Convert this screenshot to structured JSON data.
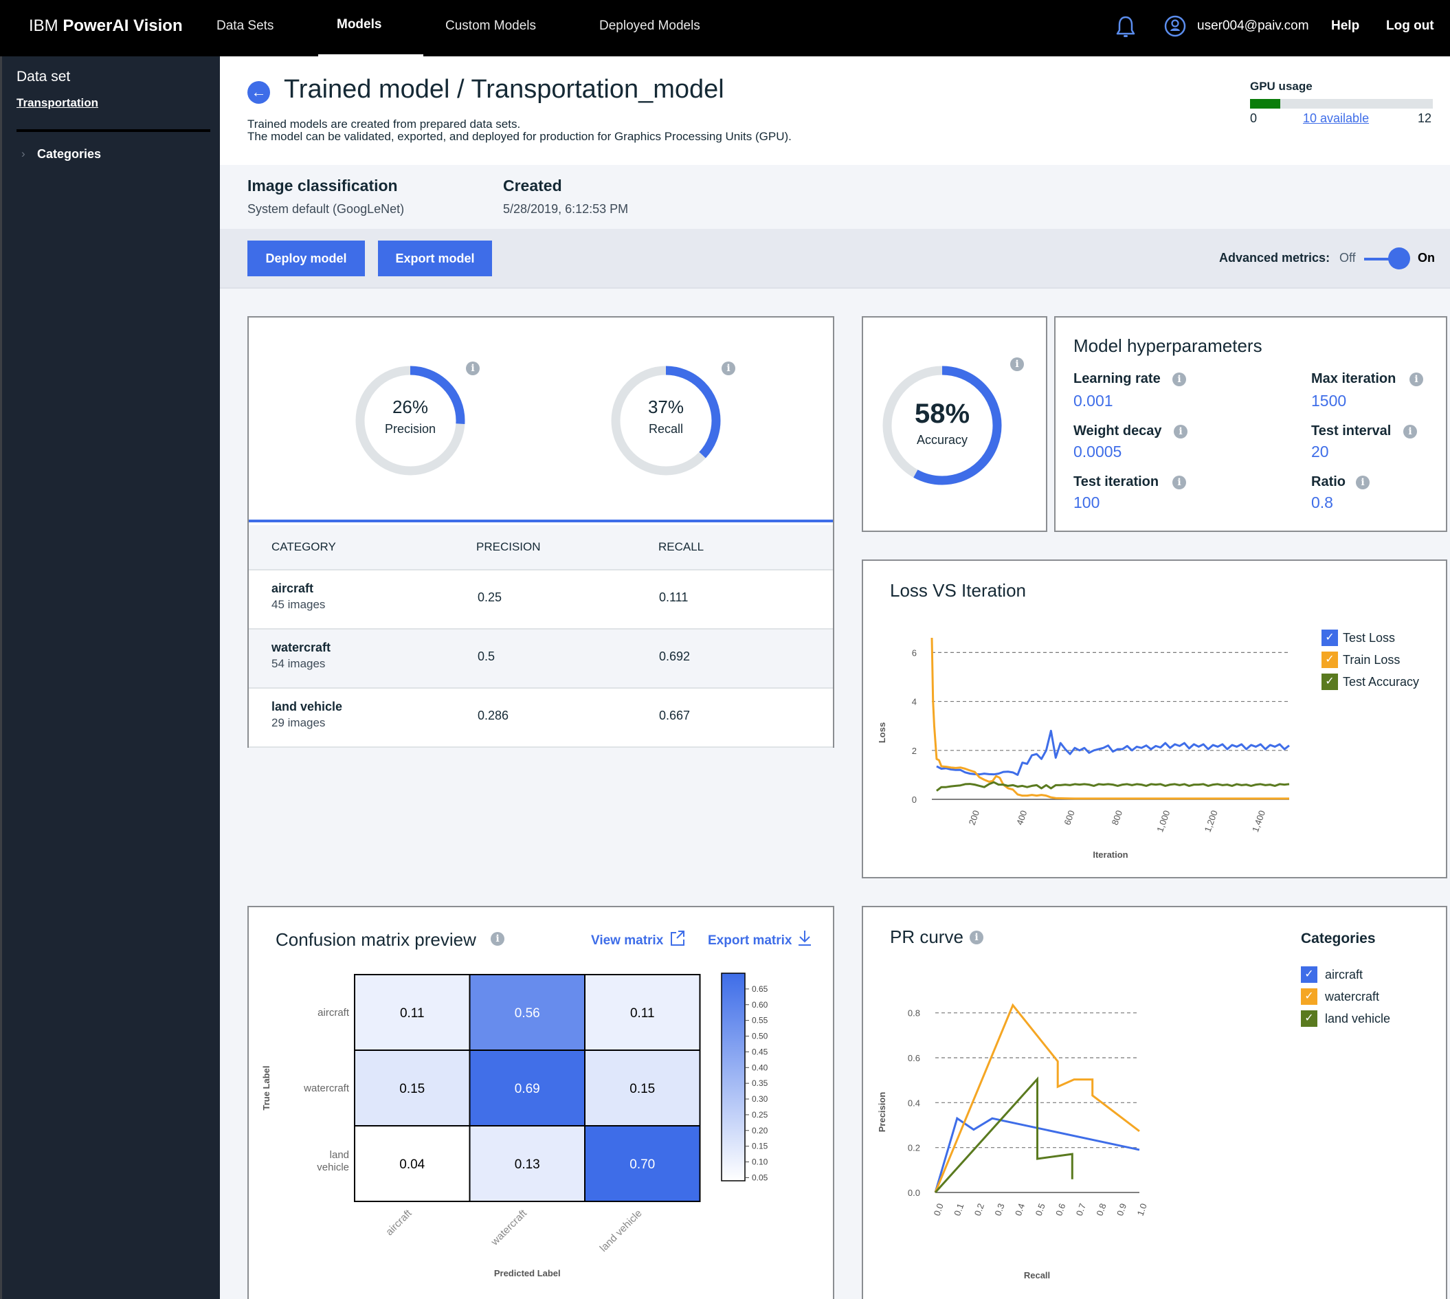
{
  "nav": {
    "brand_prefix": "IBM",
    "brand_name": "PowerAI Vision",
    "tabs": [
      {
        "label": "Data Sets",
        "active": false
      },
      {
        "label": "Models",
        "active": true
      },
      {
        "label": "Custom Models",
        "active": false
      },
      {
        "label": "Deployed Models",
        "active": false
      }
    ],
    "bell_icon": "bell-icon",
    "user_icon": "user-avatar-icon",
    "user_email": "user004@paiv.com",
    "help": "Help",
    "logout": "Log out"
  },
  "sidebar": {
    "title": "Data set",
    "dataset_link": "Transportation",
    "categories_label": "Categories",
    "chevron_icon": "chevron-right-icon"
  },
  "header": {
    "back_icon": "arrow-left-icon",
    "title": "Trained model / Transportation_model",
    "description_line1": "Trained models are created from prepared data sets.",
    "description_line2": "The model can be validated, exported, and deployed for production for Graphics Processing Units (GPU).",
    "gpu": {
      "label": "GPU usage",
      "min": "0",
      "available_link": "10 available",
      "max": "12",
      "used": 2,
      "total": 12,
      "fill_color": "#0a7d0a"
    }
  },
  "info": {
    "type_heading": "Image classification",
    "type_value": "System default (GoogLeNet)",
    "created_heading": "Created",
    "created_value": "5/28/2019, 6:12:53 PM"
  },
  "actions": {
    "deploy": "Deploy model",
    "export": "Export model",
    "advanced_label": "Advanced metrics:",
    "off": "Off",
    "on": "On",
    "advanced_enabled": true
  },
  "metrics": {
    "precision": {
      "percent": 26,
      "text": "26%",
      "label": "Precision"
    },
    "recall": {
      "percent": 37,
      "text": "37%",
      "label": "Recall"
    },
    "accuracy": {
      "percent": 58,
      "text": "58%",
      "label": "Accuracy"
    },
    "accent": "#3e6de8",
    "track": "#dfe3e6"
  },
  "category_table": {
    "headers": [
      "CATEGORY",
      "PRECISION",
      "RECALL"
    ],
    "rows": [
      {
        "category": "aircraft",
        "images": "45 images",
        "precision": "0.25",
        "recall": "0.111"
      },
      {
        "category": "watercraft",
        "images": "54 images",
        "precision": "0.5",
        "recall": "0.692"
      },
      {
        "category": "land vehicle",
        "images": "29 images",
        "precision": "0.286",
        "recall": "0.667"
      }
    ]
  },
  "hyperparameters": {
    "title": "Model hyperparameters",
    "items": [
      {
        "label": "Learning rate",
        "value": "0.001"
      },
      {
        "label": "Max iteration",
        "value": "1500"
      },
      {
        "label": "Weight decay",
        "value": "0.0005"
      },
      {
        "label": "Test interval",
        "value": "20"
      },
      {
        "label": "Test iteration",
        "value": "100"
      },
      {
        "label": "Ratio",
        "value": "0.8"
      }
    ]
  },
  "confusion": {
    "title": "Confusion matrix preview",
    "view_link": "View matrix",
    "export_link": "Export matrix"
  },
  "pr_card": {
    "title": "PR curve"
  },
  "chart_data": [
    {
      "id": "loss",
      "type": "line",
      "title": "Loss VS Iteration",
      "xlabel": "Iteration",
      "ylabel": "Loss",
      "xlim": [
        0,
        1500
      ],
      "ylim": [
        0,
        6.6
      ],
      "xticks": [
        200,
        400,
        600,
        800,
        1000,
        1200,
        1400
      ],
      "xtick_labels": [
        "200",
        "400",
        "600",
        "800",
        "1,000",
        "1,200",
        "1,400"
      ],
      "yticks": [
        0,
        2,
        4,
        6
      ],
      "grid": true,
      "legend": "right",
      "series": [
        {
          "name": "Test Loss",
          "color": "#3e6de8",
          "x": [
            20,
            40,
            60,
            80,
            100,
            120,
            140,
            160,
            180,
            200,
            220,
            240,
            260,
            280,
            300,
            320,
            340,
            360,
            380,
            400,
            420,
            440,
            460,
            480,
            500,
            520,
            540,
            560,
            580,
            600,
            620,
            640,
            660,
            680,
            700,
            720,
            740,
            760,
            780,
            800,
            820,
            840,
            860,
            880,
            900,
            920,
            940,
            960,
            980,
            1000,
            1020,
            1040,
            1060,
            1080,
            1100,
            1120,
            1140,
            1160,
            1180,
            1200,
            1220,
            1240,
            1260,
            1280,
            1300,
            1320,
            1340,
            1360,
            1380,
            1400,
            1420,
            1440,
            1460,
            1480,
            1500
          ],
          "y": [
            1.35,
            1.25,
            1.27,
            1.22,
            1.2,
            1.2,
            1.1,
            1.05,
            1.03,
            1.02,
            1.05,
            1.03,
            1.02,
            1.05,
            1.12,
            1.13,
            1.1,
            1.0,
            1.5,
            1.45,
            1.8,
            1.85,
            1.65,
            2.0,
            2.8,
            1.7,
            2.3,
            2.05,
            1.85,
            2.1,
            2.0,
            2.1,
            1.9,
            2.0,
            2.05,
            2.1,
            2.2,
            1.95,
            2.05,
            2.05,
            2.18,
            2.0,
            2.15,
            2.1,
            2.2,
            2.05,
            2.18,
            2.12,
            2.3,
            2.1,
            2.25,
            2.18,
            2.3,
            2.08,
            2.25,
            2.15,
            2.25,
            2.05,
            2.22,
            2.15,
            2.25,
            2.05,
            2.22,
            2.15,
            2.25,
            2.05,
            2.22,
            2.15,
            2.25,
            2.05,
            2.22,
            2.15,
            2.25,
            2.05,
            2.2
          ]
        },
        {
          "name": "Train Loss",
          "color": "#f5a623",
          "x": [
            0,
            5,
            10,
            20,
            30,
            40,
            60,
            80,
            100,
            120,
            140,
            160,
            180,
            200,
            220,
            240,
            255,
            270,
            285,
            300,
            320,
            340,
            360,
            380,
            400,
            420,
            440,
            460,
            480,
            500,
            520,
            560,
            600,
            700,
            800,
            900,
            1000,
            1100,
            1200,
            1300,
            1400,
            1500
          ],
          "y": [
            6.6,
            4.0,
            3.0,
            1.65,
            1.6,
            1.35,
            1.33,
            1.3,
            1.28,
            1.3,
            1.25,
            1.18,
            1.12,
            0.9,
            0.8,
            0.72,
            0.75,
            0.95,
            0.88,
            0.6,
            0.45,
            0.4,
            0.2,
            0.15,
            0.15,
            0.18,
            0.15,
            0.18,
            0.15,
            0.08,
            0.05,
            0.04,
            0.03,
            0.03,
            0.03,
            0.03,
            0.03,
            0.03,
            0.03,
            0.03,
            0.03,
            0.03
          ]
        },
        {
          "name": "Test Accuracy",
          "color": "#5a7a1f",
          "x": [
            20,
            40,
            60,
            80,
            100,
            120,
            140,
            160,
            180,
            200,
            220,
            240,
            260,
            280,
            300,
            320,
            340,
            360,
            380,
            400,
            420,
            440,
            460,
            480,
            500,
            520,
            540,
            560,
            580,
            600,
            620,
            640,
            660,
            680,
            700,
            720,
            740,
            760,
            780,
            800,
            820,
            840,
            860,
            880,
            900,
            920,
            940,
            960,
            980,
            1000,
            1020,
            1040,
            1060,
            1080,
            1100,
            1120,
            1140,
            1160,
            1180,
            1200,
            1220,
            1240,
            1260,
            1280,
            1300,
            1320,
            1340,
            1360,
            1380,
            1400,
            1420,
            1440,
            1460,
            1480,
            1500
          ],
          "y": [
            0.35,
            0.5,
            0.5,
            0.53,
            0.55,
            0.57,
            0.62,
            0.63,
            0.6,
            0.55,
            0.5,
            0.62,
            0.7,
            0.6,
            0.6,
            0.55,
            0.58,
            0.52,
            0.55,
            0.5,
            0.55,
            0.58,
            0.45,
            0.58,
            0.45,
            0.58,
            0.58,
            0.6,
            0.58,
            0.62,
            0.6,
            0.62,
            0.6,
            0.55,
            0.62,
            0.6,
            0.62,
            0.6,
            0.55,
            0.6,
            0.62,
            0.58,
            0.62,
            0.6,
            0.55,
            0.62,
            0.6,
            0.62,
            0.55,
            0.6,
            0.62,
            0.58,
            0.62,
            0.55,
            0.6,
            0.6,
            0.62,
            0.55,
            0.6,
            0.62,
            0.58,
            0.6,
            0.55,
            0.62,
            0.58,
            0.6,
            0.55,
            0.6,
            0.62,
            0.58,
            0.6,
            0.55,
            0.62,
            0.6,
            0.62
          ]
        }
      ]
    },
    {
      "id": "confusion",
      "type": "heatmap",
      "title": "Confusion matrix preview",
      "xlabel": "Predicted Label",
      "ylabel": "True Label",
      "row_labels": [
        "aircraft",
        "watercraft",
        "land vehicle"
      ],
      "col_labels": [
        "aircraft",
        "watercraft",
        "land vehicle"
      ],
      "values": [
        [
          0.11,
          0.56,
          0.11
        ],
        [
          0.15,
          0.69,
          0.15
        ],
        [
          0.04,
          0.13,
          0.7
        ]
      ],
      "value_labels": [
        [
          "0.11",
          "0.56",
          "0.11"
        ],
        [
          "0.15",
          "0.69",
          "0.15"
        ],
        [
          "0.04",
          "0.13",
          "0.70"
        ]
      ],
      "colorbar_range": [
        0.04,
        0.7
      ],
      "colorbar_ticks": [
        "0.65",
        "0.60",
        "0.55",
        "0.50",
        "0.45",
        "0.40",
        "0.35",
        "0.30",
        "0.25",
        "0.20",
        "0.15",
        "0.10",
        "0.05"
      ],
      "color_low": "#ffffff",
      "color_high": "#3e6de8"
    },
    {
      "id": "pr",
      "type": "line",
      "title": "PR curve",
      "xlabel": "Recall",
      "ylabel": "Precision",
      "xlim": [
        0,
        1.0
      ],
      "ylim": [
        0,
        0.9
      ],
      "xtick_labels": [
        "0.0",
        "0.1",
        "0.2",
        "0.3",
        "0.4",
        "0.5",
        "0.6",
        "0.7",
        "0.8",
        "0.9",
        "1.0"
      ],
      "yticks": [
        0.0,
        0.2,
        0.4,
        0.6,
        0.8
      ],
      "ytick_labels": [
        "0.0",
        "0.2",
        "0.4",
        "0.6",
        "0.8"
      ],
      "grid": true,
      "legend_title": "Categories",
      "legend": "right",
      "series": [
        {
          "name": "aircraft",
          "color": "#3e6de8",
          "x": [
            0,
            0.107,
            0.188,
            0.279,
            1.0
          ],
          "y": [
            0,
            0.33,
            0.28,
            0.33,
            0.19
          ]
        },
        {
          "name": "watercraft",
          "color": "#f5a623",
          "x": [
            0,
            0.38,
            0.6,
            0.6,
            0.68,
            0.77,
            0.77,
            1.0
          ],
          "y": [
            0,
            0.834,
            0.584,
            0.471,
            0.503,
            0.503,
            0.432,
            0.273
          ]
        },
        {
          "name": "land vehicle",
          "color": "#5a7a1f",
          "x": [
            0,
            0.5,
            0.5,
            0.671,
            0.671
          ],
          "y": [
            0,
            0.505,
            0.15,
            0.171,
            0.059
          ]
        }
      ]
    }
  ]
}
